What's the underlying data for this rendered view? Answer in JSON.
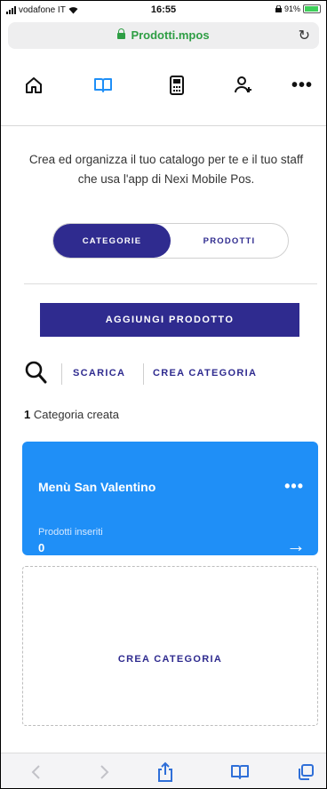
{
  "status_bar": {
    "carrier": "vodafone IT",
    "time": "16:55",
    "battery": "91%"
  },
  "browser": {
    "url": "Prodotti.mpos"
  },
  "intro_text": "Crea ed organizza il tuo catalogo per te e il tuo staff che usa l'app di Nexi Mobile Pos.",
  "segmented": {
    "active": "CATEGORIE",
    "inactive": "PRODOTTI"
  },
  "add_product_label": "AGGIUNGI PRODOTTO",
  "actions": {
    "download": "SCARICA",
    "create_category": "CREA CATEGORIA"
  },
  "category_count": {
    "number": "1",
    "text": "Categoria creata"
  },
  "category_card": {
    "title": "Menù San Valentino",
    "subtitle": "Prodotti inseriti",
    "value": "0",
    "color": "#1f8ff7"
  },
  "create_tile_label": "CREA CATEGORIA",
  "colors": {
    "brand": "#2f2b8f",
    "accent": "#1f8ff7",
    "secure": "#2e9e44"
  },
  "icons": [
    "home-icon",
    "catalog-book-icon",
    "pos-terminal-icon",
    "add-user-icon",
    "more-icon",
    "search-icon",
    "arrow-right-icon",
    "back-icon",
    "forward-icon",
    "share-icon",
    "bookmarks-icon",
    "tabs-icon",
    "reload-icon",
    "lock-icon"
  ]
}
